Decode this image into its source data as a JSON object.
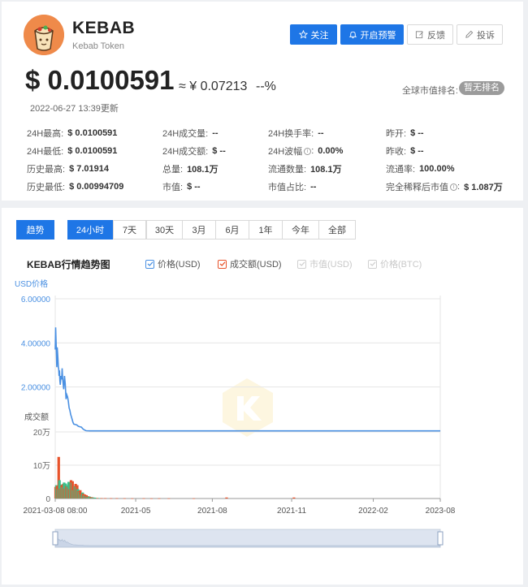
{
  "coin": {
    "symbol": "KEBAB",
    "name": "Kebab Token",
    "logo_icon": "kebab-wrap-icon"
  },
  "actions": [
    {
      "label": "关注",
      "icon": "star-icon",
      "style": "primary"
    },
    {
      "label": "开启预警",
      "icon": "bell-icon",
      "style": "primary"
    },
    {
      "label": "反馈",
      "icon": "edit-icon",
      "style": "ghost"
    },
    {
      "label": "投诉",
      "icon": "pencil-icon",
      "style": "ghost"
    }
  ],
  "price": {
    "usd": "$ 0.0100591",
    "cny": "≈ ¥ 0.07213",
    "change": "--%",
    "updated": "2022-06-27 13:39更新"
  },
  "rank": {
    "label": "全球市值排名:",
    "badge": "暂无排名"
  },
  "stats": [
    [
      {
        "label": "24H最高:",
        "value": "$ 0.0100591"
      },
      {
        "label": "24H成交量:",
        "value": "--"
      },
      {
        "label": "24H换手率:",
        "value": "--"
      },
      {
        "label": "昨开:",
        "value": "$ --"
      }
    ],
    [
      {
        "label": "24H最低:",
        "value": "$ 0.0100591"
      },
      {
        "label": "24H成交额:",
        "value": "$ --"
      },
      {
        "label": "24H波幅",
        "value": "0.00%",
        "info": true
      },
      {
        "label": "昨收:",
        "value": "$ --"
      }
    ],
    [
      {
        "label": "历史最高:",
        "value": "$ 7.01914"
      },
      {
        "label": "总量:",
        "value": "108.1万"
      },
      {
        "label": "流通数量:",
        "value": "108.1万"
      },
      {
        "label": "流通率:",
        "value": "100.00%"
      }
    ],
    [
      {
        "label": "历史最低:",
        "value": "$ 0.00994709"
      },
      {
        "label": "市值:",
        "value": "$ --"
      },
      {
        "label": "市值占比:",
        "value": "--"
      },
      {
        "label": "完全稀释后市值",
        "value": "$ 1.087万",
        "info": true
      }
    ]
  ],
  "tabs": {
    "trend": "趋势",
    "ranges": [
      "24小时",
      "7天",
      "30天",
      "3月",
      "6月",
      "1年",
      "今年",
      "全部"
    ],
    "active_range": 0
  },
  "legend": [
    {
      "label": "价格(USD)",
      "checked": true,
      "color": "#4a90e2"
    },
    {
      "label": "成交额(USD)",
      "checked": true,
      "color": "#e8532b"
    },
    {
      "label": "市值(USD)",
      "checked": false,
      "color": "#cccccc"
    },
    {
      "label": "价格(BTC)",
      "checked": false,
      "color": "#cccccc"
    }
  ],
  "chart_data": {
    "type": "line",
    "title": "KEBAB行情趋势图",
    "price_axis_label": "USD价格",
    "volume_axis_label": "成交额",
    "x_ticks": [
      "2021-03-08 08:00",
      "2021-05",
      "2021-08",
      "2021-11",
      "2022-02",
      "2023-08"
    ],
    "price_ticks": [
      "6.00000",
      "4.00000",
      "2.00000"
    ],
    "price_ylim": [
      0,
      6
    ],
    "volume_ticks": [
      "20万",
      "10万",
      "0"
    ],
    "volume_ylim": [
      0,
      200000
    ],
    "price_series": {
      "name": "价格(USD)",
      "color": "#4a90e2",
      "x": [
        0,
        1,
        2,
        3,
        4,
        5,
        6,
        7,
        8,
        9,
        10,
        11,
        12,
        13,
        14,
        15,
        16,
        17,
        18,
        19,
        20,
        22,
        24,
        26,
        28,
        30,
        32,
        34,
        36,
        38,
        40,
        42,
        44,
        46,
        48,
        52,
        56,
        60,
        64,
        68,
        72,
        76,
        80,
        90,
        100,
        120,
        140,
        160,
        180,
        200,
        220,
        240,
        260,
        280,
        300,
        320,
        340,
        360,
        380,
        400,
        420,
        440,
        460,
        480,
        500,
        520,
        540,
        560,
        580,
        600,
        620,
        640,
        660,
        680,
        700,
        720,
        740,
        760,
        780,
        800,
        820,
        840,
        860,
        880,
        900,
        920,
        940,
        960,
        980,
        1000
      ],
      "y": [
        3.7,
        4.7,
        4.2,
        3.6,
        2.9,
        3.8,
        3.6,
        3.3,
        2.9,
        2.8,
        2.5,
        2.75,
        2.3,
        2.1,
        2.3,
        2.5,
        2.35,
        2.45,
        2.85,
        2.45,
        2.25,
        1.9,
        2.5,
        2.15,
        1.45,
        1.65,
        1.55,
        1.35,
        1.05,
        0.95,
        0.75,
        0.65,
        0.52,
        0.4,
        0.32,
        0.3,
        0.28,
        0.22,
        0.2,
        0.18,
        0.1,
        0.05,
        0.02,
        0.012,
        0.011,
        0.0105,
        0.0103,
        0.0102,
        0.0101,
        0.0101,
        0.01006,
        0.01006,
        0.01006,
        0.01006,
        0.01006,
        0.01006,
        0.01006,
        0.01006,
        0.01006,
        0.01006,
        0.01006,
        0.01006,
        0.01006,
        0.01006,
        0.01006,
        0.01006,
        0.01006,
        0.01006,
        0.01006,
        0.01006,
        0.01006,
        0.01006,
        0.01006,
        0.01006,
        0.01006,
        0.01006,
        0.01006,
        0.01006,
        0.01006,
        0.01006,
        0.01006,
        0.01006,
        0.01006,
        0.01006,
        0.01006,
        0.01006,
        0.01006,
        0.01006,
        0.01006,
        0.01006
      ]
    },
    "volume_series": {
      "name": "成交额(USD)",
      "up_color": "#3bbf8a",
      "down_color": "#e8532b",
      "bars": [
        {
          "x": 1,
          "v": 35000,
          "up": false
        },
        {
          "x": 3,
          "v": 40000,
          "up": true
        },
        {
          "x": 5,
          "v": 38000,
          "up": false
        },
        {
          "x": 7,
          "v": 28000,
          "up": true
        },
        {
          "x": 9,
          "v": 125000,
          "up": false
        },
        {
          "x": 11,
          "v": 55000,
          "up": true
        },
        {
          "x": 13,
          "v": 30000,
          "up": false
        },
        {
          "x": 15,
          "v": 42000,
          "up": true
        },
        {
          "x": 17,
          "v": 40000,
          "up": false
        },
        {
          "x": 19,
          "v": 34000,
          "up": true
        },
        {
          "x": 21,
          "v": 44000,
          "up": false
        },
        {
          "x": 23,
          "v": 48000,
          "up": true
        },
        {
          "x": 25,
          "v": 30000,
          "up": false
        },
        {
          "x": 27,
          "v": 45000,
          "up": true
        },
        {
          "x": 29,
          "v": 38000,
          "up": false
        },
        {
          "x": 31,
          "v": 40000,
          "up": true
        },
        {
          "x": 33,
          "v": 35000,
          "up": false
        },
        {
          "x": 35,
          "v": 50000,
          "up": true
        },
        {
          "x": 37,
          "v": 28000,
          "up": false
        },
        {
          "x": 39,
          "v": 46000,
          "up": true
        },
        {
          "x": 41,
          "v": 55000,
          "up": false
        },
        {
          "x": 43,
          "v": 48000,
          "up": true
        },
        {
          "x": 45,
          "v": 52000,
          "up": false
        },
        {
          "x": 47,
          "v": 25000,
          "up": true
        },
        {
          "x": 49,
          "v": 28000,
          "up": false
        },
        {
          "x": 51,
          "v": 38000,
          "up": true
        },
        {
          "x": 53,
          "v": 44000,
          "up": false
        },
        {
          "x": 55,
          "v": 35000,
          "up": true
        },
        {
          "x": 57,
          "v": 40000,
          "up": false
        },
        {
          "x": 59,
          "v": 28000,
          "up": true
        },
        {
          "x": 61,
          "v": 22000,
          "up": false
        },
        {
          "x": 63,
          "v": 20000,
          "up": true
        },
        {
          "x": 65,
          "v": 25000,
          "up": false
        },
        {
          "x": 67,
          "v": 12000,
          "up": true
        },
        {
          "x": 69,
          "v": 16000,
          "up": false
        },
        {
          "x": 71,
          "v": 18000,
          "up": true
        },
        {
          "x": 73,
          "v": 14000,
          "up": false
        },
        {
          "x": 75,
          "v": 10000,
          "up": true
        },
        {
          "x": 77,
          "v": 12000,
          "up": false
        },
        {
          "x": 79,
          "v": 8000,
          "up": true
        },
        {
          "x": 81,
          "v": 10000,
          "up": false
        },
        {
          "x": 83,
          "v": 6000,
          "up": true
        },
        {
          "x": 85,
          "v": 7000,
          "up": false
        },
        {
          "x": 87,
          "v": 5000,
          "up": true
        },
        {
          "x": 89,
          "v": 6000,
          "up": true
        },
        {
          "x": 91,
          "v": 4000,
          "up": false
        },
        {
          "x": 93,
          "v": 3000,
          "up": true
        },
        {
          "x": 95,
          "v": 4000,
          "up": false
        },
        {
          "x": 97,
          "v": 2500,
          "up": true
        },
        {
          "x": 99,
          "v": 3000,
          "up": true
        },
        {
          "x": 101,
          "v": 2000,
          "up": false
        },
        {
          "x": 103,
          "v": 2500,
          "up": true
        },
        {
          "x": 105,
          "v": 1500,
          "up": true
        },
        {
          "x": 110,
          "v": 1500,
          "up": false
        },
        {
          "x": 115,
          "v": 1200,
          "up": true
        },
        {
          "x": 120,
          "v": 1000,
          "up": false
        },
        {
          "x": 130,
          "v": 1000,
          "up": false
        },
        {
          "x": 145,
          "v": 800,
          "up": false
        },
        {
          "x": 160,
          "v": 800,
          "up": false
        },
        {
          "x": 180,
          "v": 600,
          "up": false
        },
        {
          "x": 200,
          "v": 500,
          "up": false
        },
        {
          "x": 230,
          "v": 600,
          "up": false
        },
        {
          "x": 250,
          "v": 400,
          "up": false
        },
        {
          "x": 270,
          "v": 500,
          "up": false
        },
        {
          "x": 295,
          "v": 400,
          "up": false
        },
        {
          "x": 360,
          "v": 400,
          "up": false
        },
        {
          "x": 445,
          "v": 3000,
          "up": false
        },
        {
          "x": 620,
          "v": 3000,
          "up": false
        }
      ]
    },
    "x_range": [
      0,
      1000
    ],
    "x_tick_positions": [
      0,
      209,
      408,
      614,
      826,
      1000
    ],
    "grid": "horizontal",
    "watermark_icon": "brand-watermark-icon",
    "slider": {
      "start": 0,
      "end": 1
    }
  }
}
